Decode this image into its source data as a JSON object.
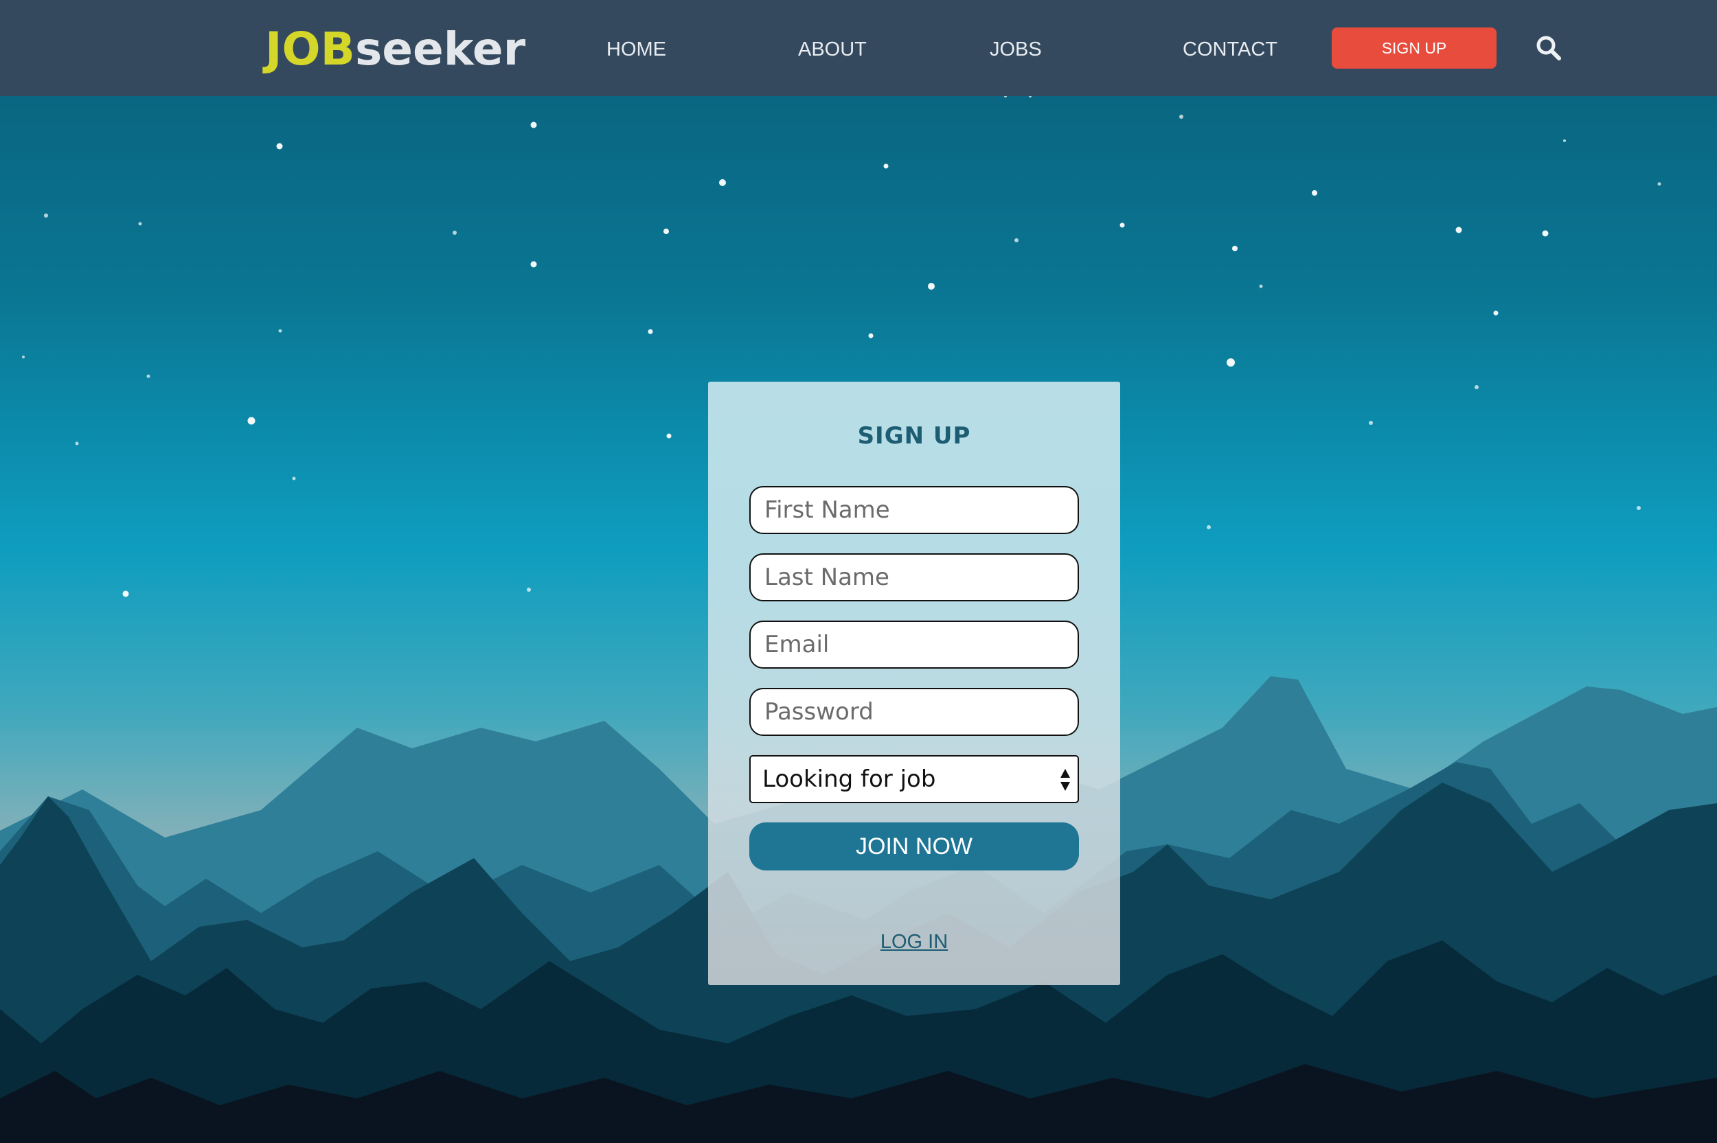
{
  "navbar": {
    "logo_part1": "JOB",
    "logo_part2": "seeker",
    "links": [
      "HOME",
      "ABOUT",
      "JOBS",
      "CONTACT"
    ],
    "signup_label": "SIGN UP",
    "search_icon": "search-icon"
  },
  "form": {
    "title": "SIGN UP",
    "first_name_placeholder": "First Name",
    "last_name_placeholder": "Last Name",
    "email_placeholder": "Email",
    "password_placeholder": "Password",
    "role_selected": "Looking for job",
    "join_label": "JOIN NOW",
    "login_label": "LOG IN"
  },
  "colors": {
    "navbar_bg": "#34495e",
    "logo_accent": "#d4d62a",
    "signup_button": "#e74c3c",
    "join_button": "#1e7594",
    "title_color": "#1c5d73"
  }
}
